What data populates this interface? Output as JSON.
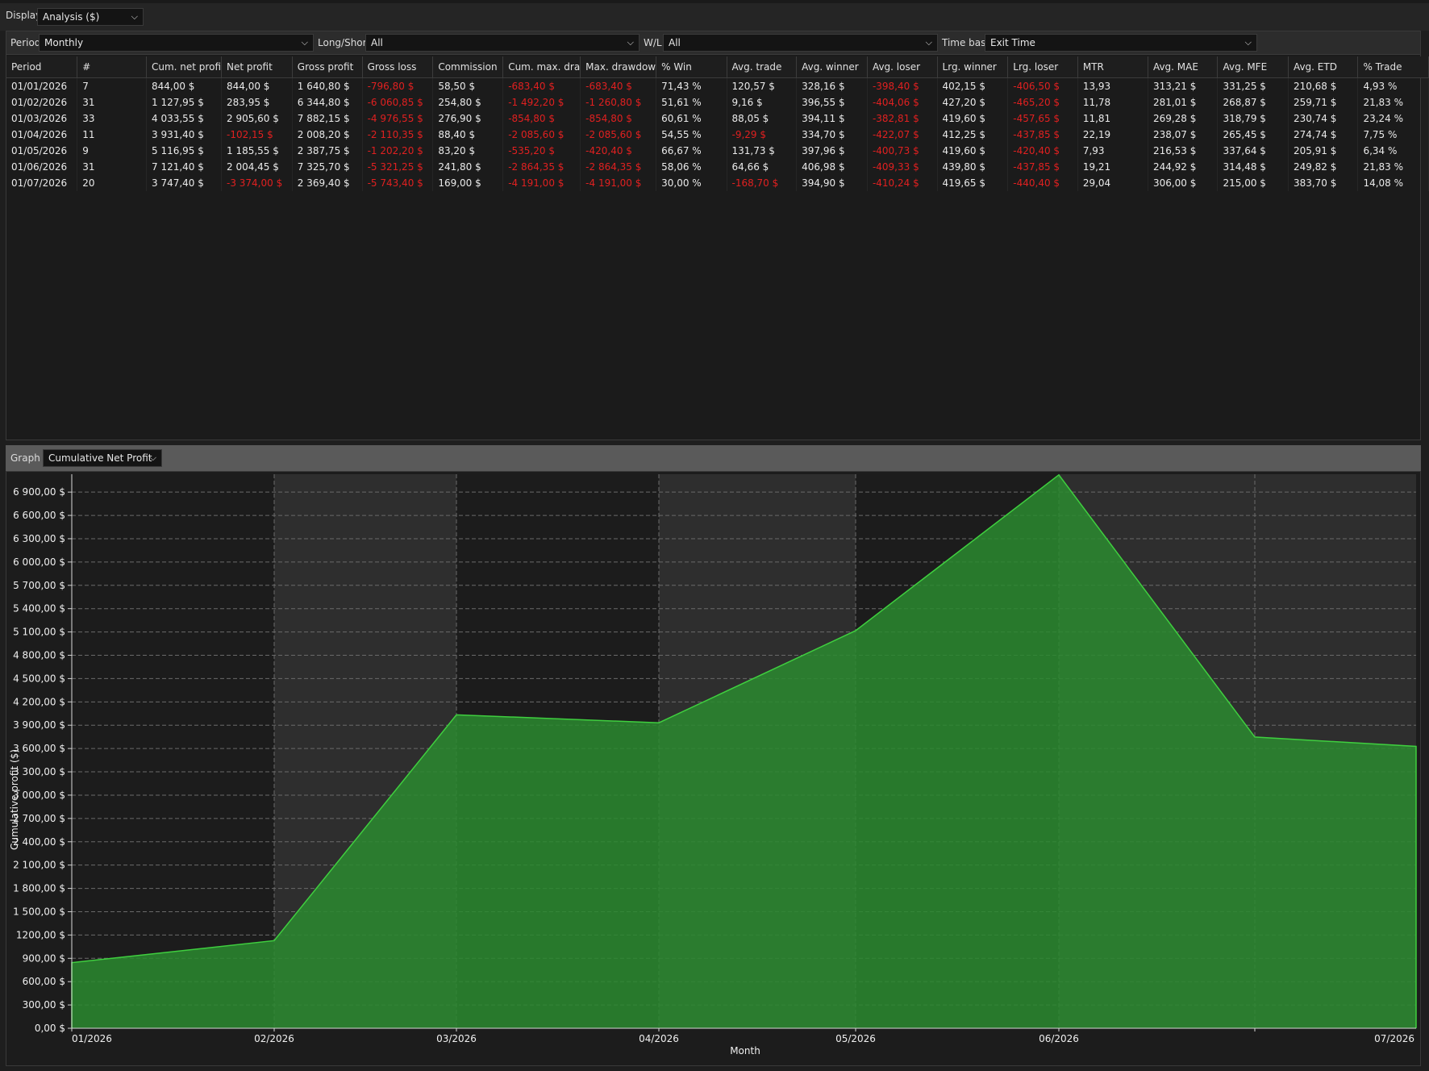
{
  "display": {
    "label": "Display",
    "value": "Analysis ($)"
  },
  "filters": {
    "period": {
      "label": "Period",
      "value": "Monthly"
    },
    "long_short": {
      "label": "Long/Short",
      "value": "All"
    },
    "wl": {
      "label": "W/L",
      "value": "All"
    },
    "time_base": {
      "label": "Time base",
      "value": "Exit Time"
    }
  },
  "table": {
    "columns": [
      "Period",
      "#",
      "Cum. net profi",
      "Net profit",
      "Gross profit",
      "Gross loss",
      "Commission",
      "Cum. max. dra",
      "Max. drawdow",
      "% Win",
      "Avg. trade",
      "Avg. winner",
      "Avg. loser",
      "Lrg. winner",
      "Lrg. loser",
      "MTR",
      "Avg. MAE",
      "Avg. MFE",
      "Avg. ETD",
      "% Trade"
    ],
    "rows": [
      [
        "01/01/2026",
        "7",
        "844,00 $",
        "844,00 $",
        "1 640,80 $",
        "-796,80 $",
        "58,50 $",
        "-683,40 $",
        "-683,40 $",
        "71,43 %",
        "120,57 $",
        "328,16 $",
        "-398,40 $",
        "402,15 $",
        "-406,50 $",
        "13,93",
        "313,21 $",
        "331,25 $",
        "210,68 $",
        "4,93 %"
      ],
      [
        "01/02/2026",
        "31",
        "1 127,95 $",
        "283,95 $",
        "6 344,80 $",
        "-6 060,85 $",
        "254,80 $",
        "-1 492,20 $",
        "-1 260,80 $",
        "51,61 %",
        "9,16 $",
        "396,55 $",
        "-404,06 $",
        "427,20 $",
        "-465,20 $",
        "11,78",
        "281,01 $",
        "268,87 $",
        "259,71 $",
        "21,83 %"
      ],
      [
        "01/03/2026",
        "33",
        "4 033,55 $",
        "2 905,60 $",
        "7 882,15 $",
        "-4 976,55 $",
        "276,90 $",
        "-854,80 $",
        "-854,80 $",
        "60,61 %",
        "88,05 $",
        "394,11 $",
        "-382,81 $",
        "419,60 $",
        "-457,65 $",
        "11,81",
        "269,28 $",
        "318,79 $",
        "230,74 $",
        "23,24 %"
      ],
      [
        "01/04/2026",
        "11",
        "3 931,40 $",
        "-102,15 $",
        "2 008,20 $",
        "-2 110,35 $",
        "88,40 $",
        "-2 085,60 $",
        "-2 085,60 $",
        "54,55 %",
        "-9,29 $",
        "334,70 $",
        "-422,07 $",
        "412,25 $",
        "-437,85 $",
        "22,19",
        "238,07 $",
        "265,45 $",
        "274,74 $",
        "7,75 %"
      ],
      [
        "01/05/2026",
        "9",
        "5 116,95 $",
        "1 185,55 $",
        "2 387,75 $",
        "-1 202,20 $",
        "83,20 $",
        "-535,20 $",
        "-420,40 $",
        "66,67 %",
        "131,73 $",
        "397,96 $",
        "-400,73 $",
        "419,60 $",
        "-420,40 $",
        "7,93",
        "216,53 $",
        "337,64 $",
        "205,91 $",
        "6,34 %"
      ],
      [
        "01/06/2026",
        "31",
        "7 121,40 $",
        "2 004,45 $",
        "7 325,70 $",
        "-5 321,25 $",
        "241,80 $",
        "-2 864,35 $",
        "-2 864,35 $",
        "58,06 %",
        "64,66 $",
        "406,98 $",
        "-409,33 $",
        "439,80 $",
        "-437,85 $",
        "19,21",
        "244,92 $",
        "314,48 $",
        "249,82 $",
        "21,83 %"
      ],
      [
        "01/07/2026",
        "20",
        "3 747,40 $",
        "-3 374,00 $",
        "2 369,40 $",
        "-5 743,40 $",
        "169,00 $",
        "-4 191,00 $",
        "-4 191,00 $",
        "30,00 %",
        "-168,70 $",
        "394,90 $",
        "-410,24 $",
        "419,65 $",
        "-440,40 $",
        "29,04",
        "306,00 $",
        "215,00 $",
        "383,70 $",
        "14,08 %"
      ]
    ]
  },
  "graph": {
    "label": "Graph",
    "value": "Cumulative Net Profit"
  },
  "chart_data": {
    "type": "area",
    "x": [
      "01/2026",
      "02/2026",
      "03/2026",
      "04/2026",
      "05/2026",
      "06/2026",
      "07/2026"
    ],
    "series": [
      {
        "values": [
          844.0,
          1127.95,
          4033.55,
          3931.4,
          5116.95,
          7121.4,
          3747.4
        ]
      }
    ],
    "xlabel": "Month",
    "ylabel": "Cumulative profit ($)",
    "y_ticks": [
      "0,00 $",
      "300,00 $",
      "600,00 $",
      "900,00 $",
      "1200,00 $",
      "1 500,00 $",
      "1 800,00 $",
      "2 100,00 $",
      "2 400,00 $",
      "2 700,00 $",
      "3 000,00 $",
      "3 300,00 $",
      "3 600,00 $",
      "3 900,00 $",
      "4 200,00 $",
      "4 500,00 $",
      "4 800,00 $",
      "5 100,00 $",
      "5 400,00 $",
      "5 700,00 $",
      "6 000,00 $",
      "6 300,00 $",
      "6 600,00 $",
      "6 900,00 $"
    ],
    "ylim": [
      0,
      7130
    ],
    "grid": true,
    "colors": {
      "fill": "#2a8a2f",
      "line": "#3fcf3f",
      "band": "#2e2e2e"
    }
  }
}
